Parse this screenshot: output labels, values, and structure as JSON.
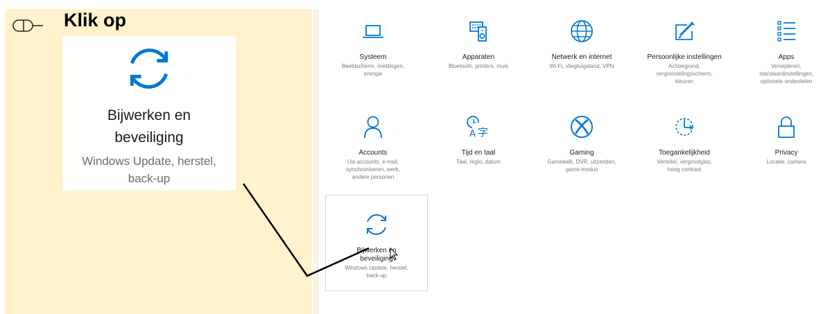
{
  "instruction": "Klik op",
  "zoom": {
    "icon": "sync-icon",
    "title_line1": "Bijwerken en",
    "title_line2": "beveiliging",
    "desc_line1": "Windows Update, herstel,",
    "desc_line2": "back-up"
  },
  "tiles": [
    {
      "icon": "laptop-icon",
      "title": "Systeem",
      "desc": [
        "Beeldscherm, meldingen,",
        "energie"
      ]
    },
    {
      "icon": "keyboard-speaker-icon",
      "title": "Apparaten",
      "desc": [
        "Bluetooth, printers, muis"
      ]
    },
    {
      "icon": "globe-icon",
      "title": "Netwerk en internet",
      "desc": [
        "Wi-Fi, vliegtuigstand, VPN"
      ]
    },
    {
      "icon": "paint-brush-icon",
      "title": "Persoonlijke instellingen",
      "desc": [
        "Achtergrond,",
        "vergrendelingsscherm,",
        "kleuren"
      ]
    },
    {
      "icon": "apps-list-icon",
      "title": "Apps",
      "desc": [
        "Verwijderen,",
        "standaardinstellingen,",
        "optionele onderdelen"
      ]
    },
    {
      "icon": "person-icon",
      "title": "Accounts",
      "desc": [
        "Uw accounts, e-mail,",
        "synchroniseren, werk,",
        "andere personen"
      ]
    },
    {
      "icon": "time-language-icon",
      "title": "Tijd en taal",
      "desc": [
        "Taal, regio, datum"
      ]
    },
    {
      "icon": "xbox-icon",
      "title": "Gaming",
      "desc": [
        "Gamebalk, DVR, uitzenden,",
        "game-modus"
      ]
    },
    {
      "icon": "ease-of-access-icon",
      "title": "Toegankelijkheid",
      "desc": [
        "Verteller, vergrootglas,",
        "hoog contrast"
      ]
    },
    {
      "icon": "lock-icon",
      "title": "Privacy",
      "desc": [
        "Locatie, camera"
      ]
    },
    {
      "icon": "sync-icon",
      "title": "Bijwerken en beveiliging",
      "desc": [
        "Windows Update, herstel,",
        "back-up"
      ]
    }
  ],
  "colors": {
    "accent": "#0078d7",
    "note_background": "#fff2cc"
  }
}
